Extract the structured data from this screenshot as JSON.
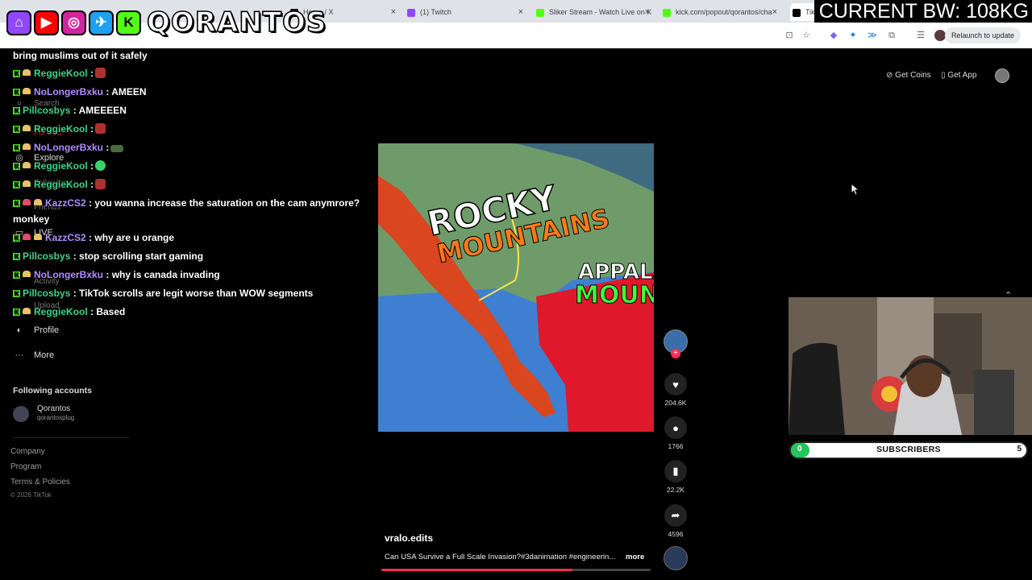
{
  "browser": {
    "tabs": [
      {
        "title": "Home / X",
        "fav_color": "#000000"
      },
      {
        "title": "(1) Twitch",
        "fav_color": "#9146ff"
      },
      {
        "title": "Sliker Stream - Watch Live on K",
        "fav_color": "#53fc18"
      },
      {
        "title": "kick.com/popout/qorantos/cha",
        "fav_color": "#53fc18"
      },
      {
        "title": "TikTok",
        "fav_color": "#000000"
      }
    ],
    "relaunch_label": "Relaunch to update"
  },
  "overlay": {
    "brand": "QORANTOS",
    "bandwidth": "CURRENT BW: 108KG",
    "socials": [
      "twitch-icon",
      "youtube-icon",
      "instagram-icon",
      "twitter-icon",
      "kick-icon"
    ]
  },
  "nav": {
    "ghost_search": "Search",
    "ghost_for_you": "For You",
    "explore": "Explore",
    "following": "Following",
    "friends": "Friends",
    "live": "LIVE",
    "activity": "Activity",
    "upload": "Upload",
    "profile": "Profile",
    "more": "More",
    "following_accounts_heading": "Following accounts",
    "account": {
      "name": "Qorantos",
      "handle": "qorantosplug"
    },
    "footer": {
      "company": "Company",
      "program": "Program",
      "terms": "Terms & Policies",
      "copyright": "© 2026 TikTok"
    }
  },
  "chat": {
    "messages": [
      {
        "user": "",
        "text": "bring muslims out of it safely"
      },
      {
        "user": "ReggieKool",
        "text": ":"
      },
      {
        "user": "NoLongerBxku",
        "text": ": AMEEN"
      },
      {
        "user": "Pillcosbys",
        "text": ": AMEEEEN"
      },
      {
        "user": "ReggieKool",
        "text": ":"
      },
      {
        "user": "NoLongerBxku",
        "text": ":"
      },
      {
        "user": "ReggieKool",
        "text": ":"
      },
      {
        "user": "ReggieKool",
        "text": ":"
      },
      {
        "user": "KazzCS2",
        "text": ": you wanna increase the saturation on the cam anymrore?"
      },
      {
        "user": "",
        "text": "monkey"
      },
      {
        "user": "KazzCS2",
        "text": ": why are u orange"
      },
      {
        "user": "Pillcosbys",
        "text": ": stop scrolling start gaming"
      },
      {
        "user": "NoLongerBxku",
        "text": ": why is canada invading"
      },
      {
        "user": "Pillcosbys",
        "text": ": TikTok scrolls are legit worse than WOW segments"
      },
      {
        "user": "ReggieKool",
        "text": ": Based"
      }
    ]
  },
  "header": {
    "get_coins": "Get Coins",
    "get_app": "Get App"
  },
  "video": {
    "title_line1": "ROCKY",
    "title_line2": "MOUNTAINS",
    "title_right1": "APPALA",
    "title_right2": "MOUNT",
    "author": "vralo.edits",
    "description": "Can USA Survive a Full Scale Invasion?#3danimation #engineerin...",
    "more": "more",
    "progress": 0.71
  },
  "actions": {
    "likes": "204.6K",
    "comments": "1766",
    "saves": "22.2K",
    "shares": "4596"
  },
  "subs": {
    "start": "0",
    "label": "SUBSCRIBERS",
    "goal": "5",
    "progress": 0.08
  }
}
